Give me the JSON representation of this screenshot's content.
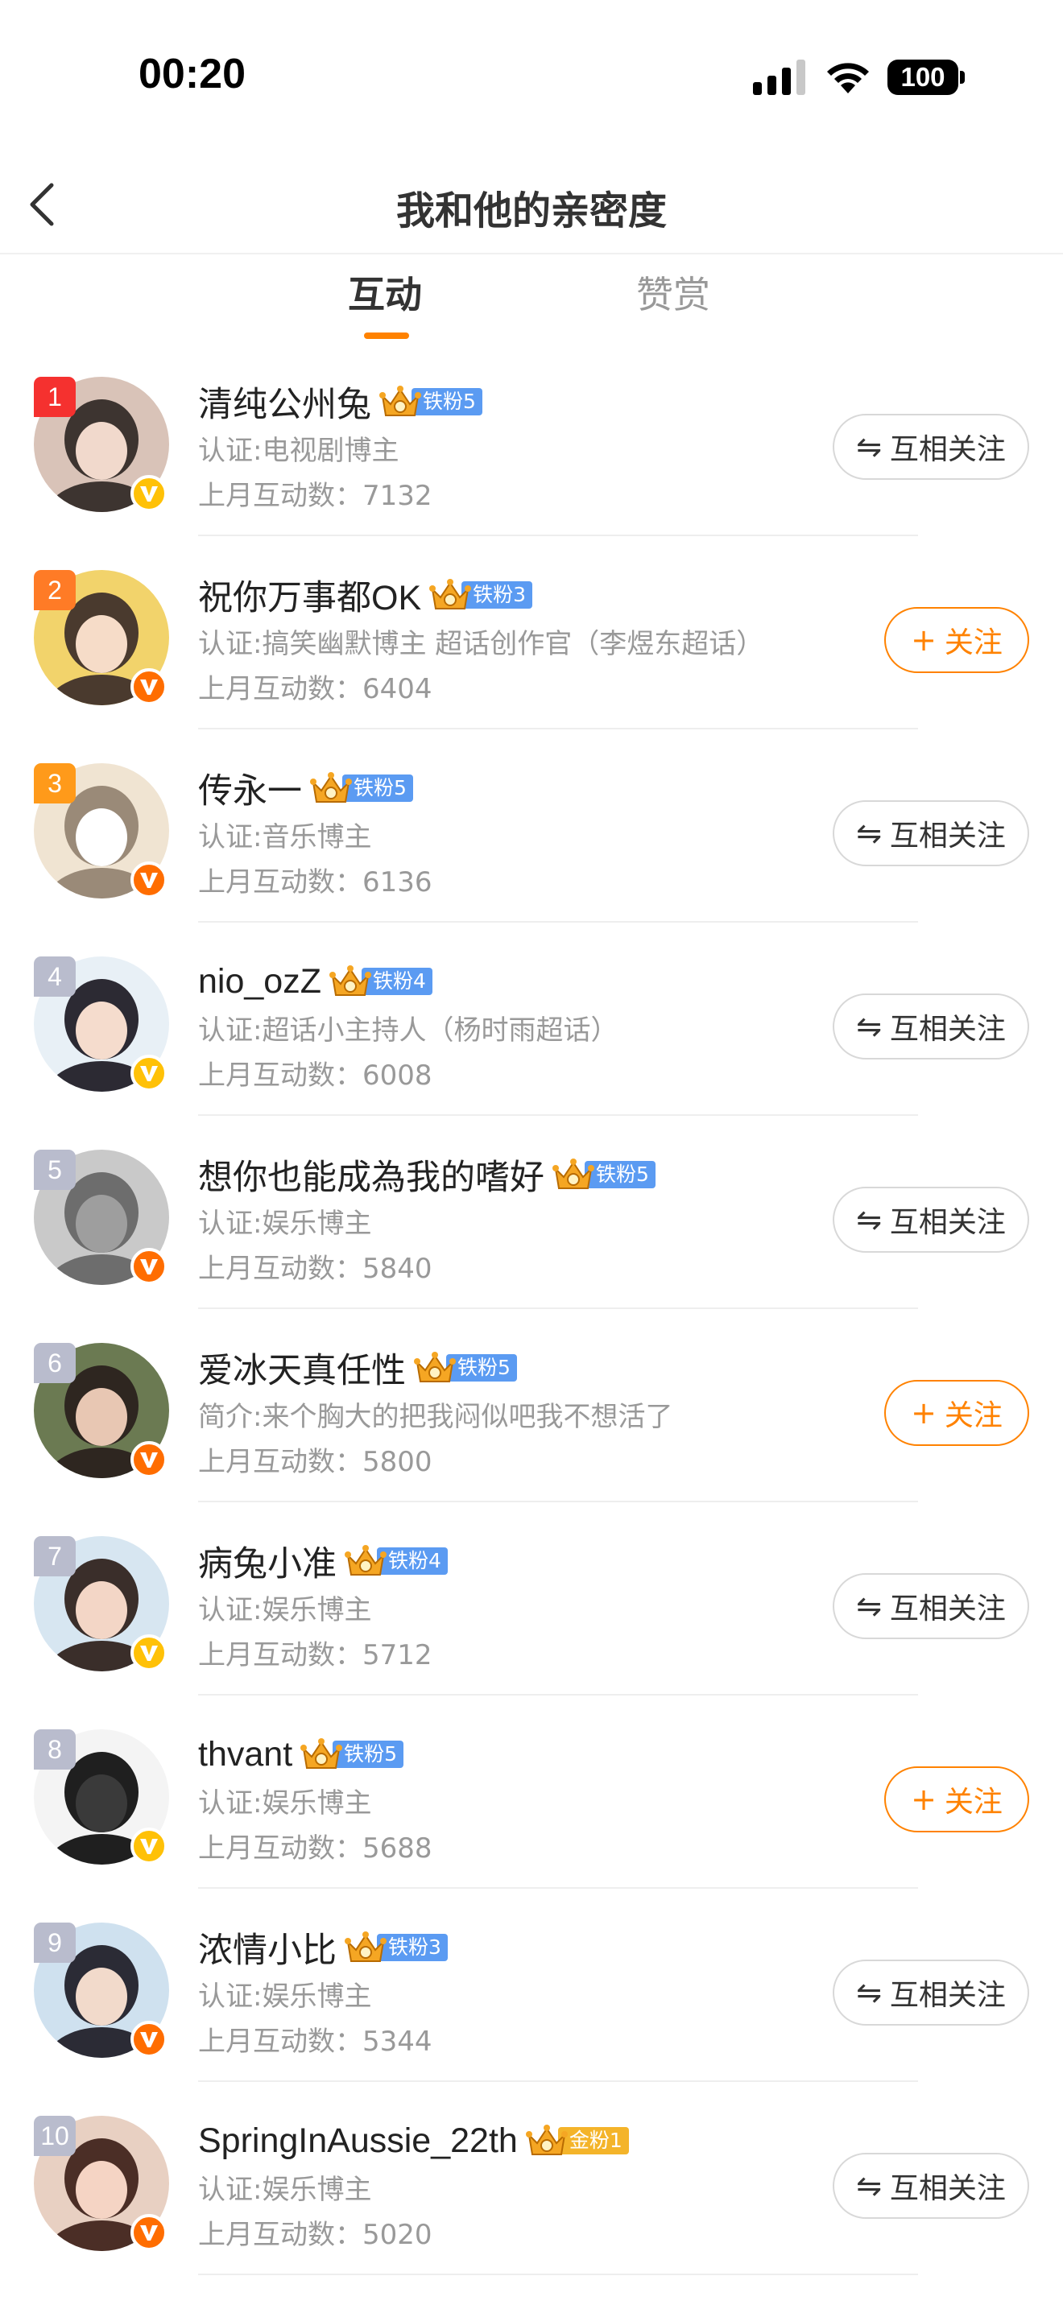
{
  "status": {
    "time": "00:20",
    "battery": "100"
  },
  "nav": {
    "title": "我和他的亲密度"
  },
  "tabs": [
    {
      "label": "互动",
      "active": true
    },
    {
      "label": "赞赏",
      "active": false
    }
  ],
  "labels": {
    "mutual": "互相关注",
    "follow": "关注",
    "count_prefix": "上月互动数："
  },
  "colors": {
    "accent": "#ff8200",
    "fan_blue": "#5b9bf2",
    "fan_gold": "#f4b42a"
  },
  "users": [
    {
      "rank": "1",
      "name": "清纯公州兔",
      "fan": "铁粉5",
      "desc": "认证:电视剧博主",
      "count": "7132",
      "action": "mutual"
    },
    {
      "rank": "2",
      "name": "祝你万事都OK",
      "fan": "铁粉3",
      "desc": "认证:搞笑幽默博主 超话创作官（李煜东超话）",
      "count": "6404",
      "action": "follow"
    },
    {
      "rank": "3",
      "name": "传永一",
      "fan": "铁粉5",
      "desc": "认证:音乐博主",
      "count": "6136",
      "action": "mutual"
    },
    {
      "rank": "4",
      "name": "nio_ozZ",
      "fan": "铁粉4",
      "desc": "认证:超话小主持人（杨时雨超话）",
      "count": "6008",
      "action": "mutual"
    },
    {
      "rank": "5",
      "name": "想你也能成為我的嗜好",
      "fan": "铁粉5",
      "desc": "认证:娱乐博主",
      "count": "5840",
      "action": "mutual"
    },
    {
      "rank": "6",
      "name": "爱冰天真任性",
      "fan": "铁粉5",
      "desc": "简介:来个胸大的把我闷似吧我不想活了",
      "count": "5800",
      "action": "follow"
    },
    {
      "rank": "7",
      "name": "病兔小准",
      "fan": "铁粉4",
      "desc": "认证:娱乐博主",
      "count": "5712",
      "action": "mutual"
    },
    {
      "rank": "8",
      "name": "thvant",
      "fan": "铁粉5",
      "desc": "认证:娱乐博主",
      "count": "5688",
      "action": "follow"
    },
    {
      "rank": "9",
      "name": "浓情小比",
      "fan": "铁粉3",
      "desc": "认证:娱乐博主",
      "count": "5344",
      "action": "mutual"
    },
    {
      "rank": "10",
      "name": "SpringInAussie_22th",
      "fan": "金粉1",
      "desc": "认证:娱乐博主",
      "count": "5020",
      "action": "mutual"
    }
  ]
}
